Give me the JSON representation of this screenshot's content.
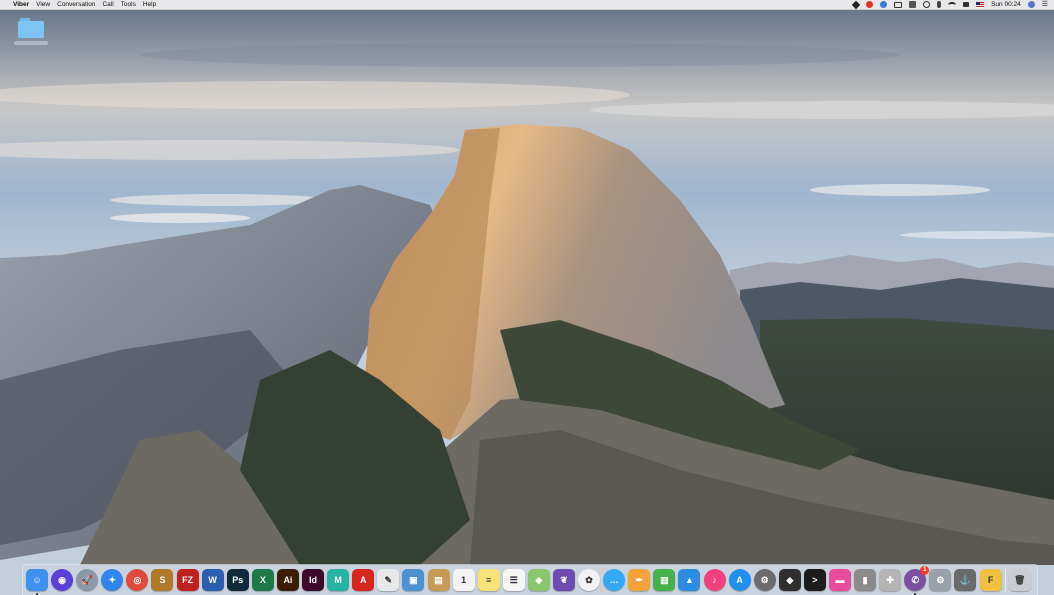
{
  "menubar": {
    "apple_glyph": "",
    "app_name": "Viber",
    "menus": [
      "View",
      "Conversation",
      "Call",
      "Tools",
      "Help"
    ],
    "clock": "Sun 00:24",
    "status_icons": [
      "location-arrow-icon",
      "record-icon",
      "cloud-icon",
      "display-icon",
      "dropbox-icon",
      "time-machine-icon",
      "bluetooth-icon",
      "wifi-icon",
      "volume-icon",
      "flag-us-icon"
    ]
  },
  "desktop": {
    "icons": [
      {
        "name": "folder-icon"
      }
    ]
  },
  "dock": {
    "items": [
      {
        "name": "finder",
        "glyph": "☺",
        "color": "#3d8ff0",
        "round": false,
        "running": true
      },
      {
        "name": "siri",
        "glyph": "◉",
        "color": "#5a3fd8",
        "round": true,
        "running": false
      },
      {
        "name": "launchpad",
        "glyph": "🚀",
        "color": "#8c98a8",
        "round": true,
        "running": false
      },
      {
        "name": "safari",
        "glyph": "✦",
        "color": "#2f86ee",
        "round": true,
        "running": false
      },
      {
        "name": "chrome",
        "glyph": "◎",
        "color": "#e2483c",
        "round": true,
        "running": false
      },
      {
        "name": "sequel",
        "glyph": "S",
        "color": "#b0782a",
        "round": false,
        "running": false
      },
      {
        "name": "filezilla",
        "glyph": "FZ",
        "color": "#c0211c",
        "round": false,
        "running": false
      },
      {
        "name": "word",
        "glyph": "W",
        "color": "#2c5fb3",
        "round": false,
        "running": false
      },
      {
        "name": "photoshop",
        "glyph": "Ps",
        "color": "#0f2a3d",
        "round": false,
        "running": false
      },
      {
        "name": "excel",
        "glyph": "X",
        "color": "#1f7845",
        "round": false,
        "running": false
      },
      {
        "name": "illustrator",
        "glyph": "Ai",
        "color": "#3b1e04",
        "round": false,
        "running": false
      },
      {
        "name": "indesign",
        "glyph": "Id",
        "color": "#3d0a2a",
        "round": false,
        "running": false
      },
      {
        "name": "maps-m",
        "glyph": "M",
        "color": "#26b3a4",
        "round": false,
        "running": false
      },
      {
        "name": "acrobat",
        "glyph": "A",
        "color": "#d8261d",
        "round": false,
        "running": false
      },
      {
        "name": "textedit",
        "glyph": "✎",
        "color": "#e8e8e8",
        "round": false,
        "running": false
      },
      {
        "name": "preview",
        "glyph": "▣",
        "color": "#4b92d4",
        "round": false,
        "running": false
      },
      {
        "name": "notes-brown",
        "glyph": "▤",
        "color": "#c59b55",
        "round": false,
        "running": false
      },
      {
        "name": "calendar",
        "glyph": "1",
        "color": "#f4f4f4",
        "round": false,
        "running": false
      },
      {
        "name": "notes",
        "glyph": "≡",
        "color": "#f7e27a",
        "round": false,
        "running": false
      },
      {
        "name": "reminders",
        "glyph": "☰",
        "color": "#f6f6f6",
        "round": false,
        "running": false
      },
      {
        "name": "maps",
        "glyph": "◈",
        "color": "#8cc66a",
        "round": false,
        "running": false
      },
      {
        "name": "feather",
        "glyph": "❦",
        "color": "#6d4bb0",
        "round": false,
        "running": false
      },
      {
        "name": "photos",
        "glyph": "✿",
        "color": "#f2f2f2",
        "round": true,
        "running": false
      },
      {
        "name": "messages",
        "glyph": "…",
        "color": "#35a9f5",
        "round": true,
        "running": false
      },
      {
        "name": "pages",
        "glyph": "✒",
        "color": "#f2a33a",
        "round": false,
        "running": false
      },
      {
        "name": "numbers",
        "glyph": "▥",
        "color": "#46b04a",
        "round": false,
        "running": false
      },
      {
        "name": "keynote",
        "glyph": "▲",
        "color": "#2d8be0",
        "round": false,
        "running": false
      },
      {
        "name": "itunes",
        "glyph": "♪",
        "color": "#f23f7d",
        "round": true,
        "running": false
      },
      {
        "name": "app-store",
        "glyph": "A",
        "color": "#1f8ff2",
        "round": true,
        "running": false
      },
      {
        "name": "system-preferences-alt",
        "glyph": "⚙",
        "color": "#6b6b6b",
        "round": true,
        "running": false
      },
      {
        "name": "disk-dark",
        "glyph": "◆",
        "color": "#2f2f2f",
        "round": false,
        "running": false
      },
      {
        "name": "terminal",
        "glyph": ">",
        "color": "#1c1c1c",
        "round": false,
        "running": false
      },
      {
        "name": "cleanmymac",
        "glyph": "▬",
        "color": "#e84c9c",
        "round": false,
        "running": false
      },
      {
        "name": "archive",
        "glyph": "▮",
        "color": "#8a8a8a",
        "round": false,
        "running": false
      },
      {
        "name": "disk-utility",
        "glyph": "✚",
        "color": "#b4b4b4",
        "round": false,
        "running": false
      },
      {
        "name": "viber",
        "glyph": "✆",
        "color": "#7b519d",
        "round": true,
        "running": true,
        "badge": "1"
      },
      {
        "name": "system-preferences",
        "glyph": "⚙",
        "color": "#9aa0a8",
        "round": false,
        "running": false
      },
      {
        "name": "anchor",
        "glyph": "⚓",
        "color": "#6a6a6a",
        "round": false,
        "running": false
      },
      {
        "name": "fontforge",
        "glyph": "F",
        "color": "#f0c040",
        "round": false,
        "running": false
      },
      {
        "name": "trash",
        "glyph": "🗑",
        "color": "#c9cdd3",
        "round": false,
        "running": false,
        "after_divider": true
      }
    ]
  }
}
